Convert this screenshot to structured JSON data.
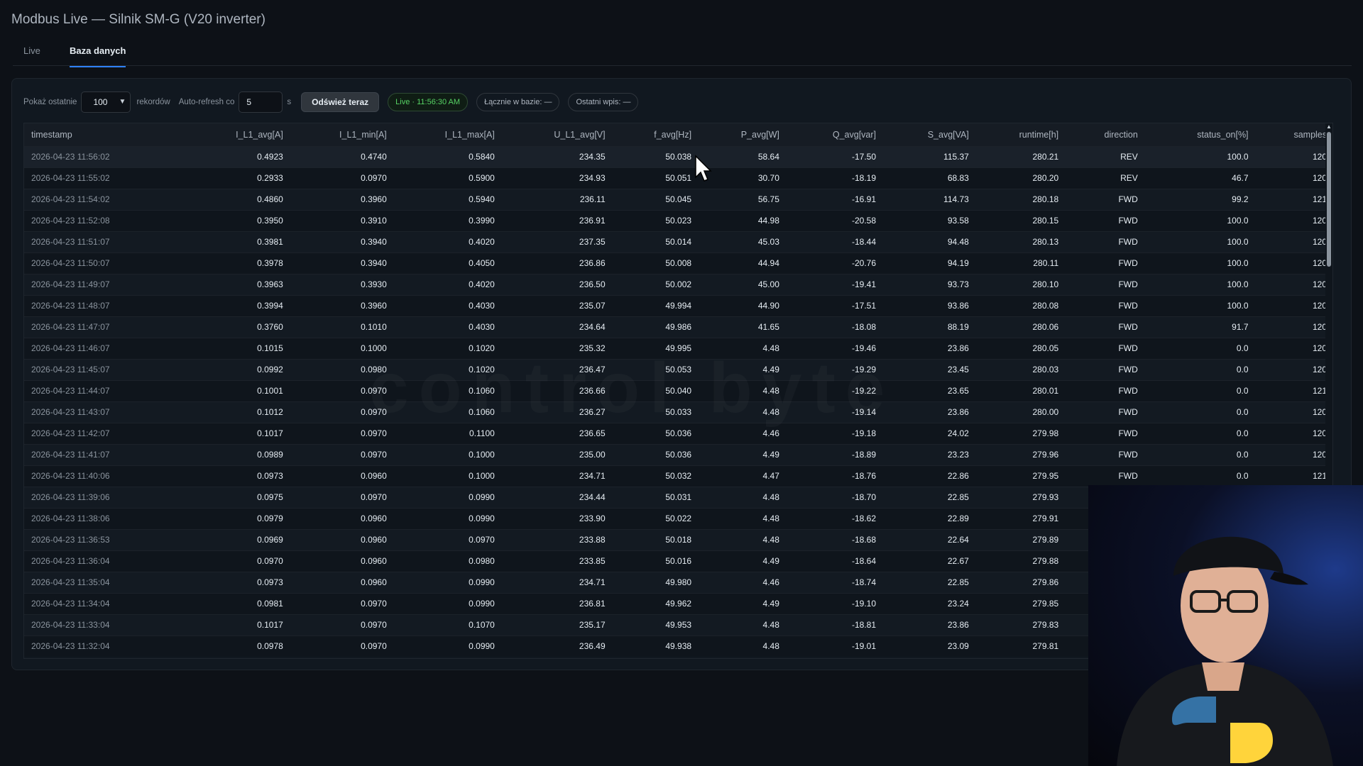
{
  "app": {
    "title": "Modbus Live — Silnik SM-G (V20 inverter)"
  },
  "tabs": [
    {
      "label": "Live"
    },
    {
      "label": "Baza danych"
    }
  ],
  "toolbar": {
    "show_last_label": "Pokaż ostatnie",
    "records_select_value": "100",
    "records_label": "rekordów",
    "autorefresh_label": "Auto-refresh co",
    "autorefresh_value": "5",
    "seconds_unit": "s",
    "refresh_button": "Odśwież teraz",
    "live_status": "Live · 11:56:30 AM",
    "total_in_db": "Łącznie w bazie: —",
    "last_entry": "Ostatni wpis: —"
  },
  "watermark": "control byte",
  "table": {
    "columns": [
      "timestamp",
      "I_L1_avg[A]",
      "I_L1_min[A]",
      "I_L1_max[A]",
      "U_L1_avg[V]",
      "f_avg[Hz]",
      "P_avg[W]",
      "Q_avg[var]",
      "S_avg[VA]",
      "runtime[h]",
      "direction",
      "status_on[%]",
      "samples"
    ],
    "rows": [
      [
        "2026-04-23 11:56:02",
        "0.4923",
        "0.4740",
        "0.5840",
        "234.35",
        "50.038",
        "58.64",
        "-17.50",
        "115.37",
        "280.21",
        "REV",
        "100.0",
        "120"
      ],
      [
        "2026-04-23 11:55:02",
        "0.2933",
        "0.0970",
        "0.5900",
        "234.93",
        "50.051",
        "30.70",
        "-18.19",
        "68.83",
        "280.20",
        "REV",
        "46.7",
        "120"
      ],
      [
        "2026-04-23 11:54:02",
        "0.4860",
        "0.3960",
        "0.5940",
        "236.11",
        "50.045",
        "56.75",
        "-16.91",
        "114.73",
        "280.18",
        "FWD",
        "99.2",
        "121"
      ],
      [
        "2026-04-23 11:52:08",
        "0.3950",
        "0.3910",
        "0.3990",
        "236.91",
        "50.023",
        "44.98",
        "-20.58",
        "93.58",
        "280.15",
        "FWD",
        "100.0",
        "120"
      ],
      [
        "2026-04-23 11:51:07",
        "0.3981",
        "0.3940",
        "0.4020",
        "237.35",
        "50.014",
        "45.03",
        "-18.44",
        "94.48",
        "280.13",
        "FWD",
        "100.0",
        "120"
      ],
      [
        "2026-04-23 11:50:07",
        "0.3978",
        "0.3940",
        "0.4050",
        "236.86",
        "50.008",
        "44.94",
        "-20.76",
        "94.19",
        "280.11",
        "FWD",
        "100.0",
        "120"
      ],
      [
        "2026-04-23 11:49:07",
        "0.3963",
        "0.3930",
        "0.4020",
        "236.50",
        "50.002",
        "45.00",
        "-19.41",
        "93.73",
        "280.10",
        "FWD",
        "100.0",
        "120"
      ],
      [
        "2026-04-23 11:48:07",
        "0.3994",
        "0.3960",
        "0.4030",
        "235.07",
        "49.994",
        "44.90",
        "-17.51",
        "93.86",
        "280.08",
        "FWD",
        "100.0",
        "120"
      ],
      [
        "2026-04-23 11:47:07",
        "0.3760",
        "0.1010",
        "0.4030",
        "234.64",
        "49.986",
        "41.65",
        "-18.08",
        "88.19",
        "280.06",
        "FWD",
        "91.7",
        "120"
      ],
      [
        "2026-04-23 11:46:07",
        "0.1015",
        "0.1000",
        "0.1020",
        "235.32",
        "49.995",
        "4.48",
        "-19.46",
        "23.86",
        "280.05",
        "FWD",
        "0.0",
        "120"
      ],
      [
        "2026-04-23 11:45:07",
        "0.0992",
        "0.0980",
        "0.1020",
        "236.47",
        "50.053",
        "4.49",
        "-19.29",
        "23.45",
        "280.03",
        "FWD",
        "0.0",
        "120"
      ],
      [
        "2026-04-23 11:44:07",
        "0.1001",
        "0.0970",
        "0.1060",
        "236.66",
        "50.040",
        "4.48",
        "-19.22",
        "23.65",
        "280.01",
        "FWD",
        "0.0",
        "121"
      ],
      [
        "2026-04-23 11:43:07",
        "0.1012",
        "0.0970",
        "0.1060",
        "236.27",
        "50.033",
        "4.48",
        "-19.14",
        "23.86",
        "280.00",
        "FWD",
        "0.0",
        "120"
      ],
      [
        "2026-04-23 11:42:07",
        "0.1017",
        "0.0970",
        "0.1100",
        "236.65",
        "50.036",
        "4.46",
        "-19.18",
        "24.02",
        "279.98",
        "FWD",
        "0.0",
        "120"
      ],
      [
        "2026-04-23 11:41:07",
        "0.0989",
        "0.0970",
        "0.1000",
        "235.00",
        "50.036",
        "4.49",
        "-18.89",
        "23.23",
        "279.96",
        "FWD",
        "0.0",
        "120"
      ],
      [
        "2026-04-23 11:40:06",
        "0.0973",
        "0.0960",
        "0.1000",
        "234.71",
        "50.032",
        "4.47",
        "-18.76",
        "22.86",
        "279.95",
        "FWD",
        "0.0",
        "121"
      ],
      [
        "2026-04-23 11:39:06",
        "0.0975",
        "0.0970",
        "0.0990",
        "234.44",
        "50.031",
        "4.48",
        "-18.70",
        "22.85",
        "279.93",
        "",
        "",
        ""
      ],
      [
        "2026-04-23 11:38:06",
        "0.0979",
        "0.0960",
        "0.0990",
        "233.90",
        "50.022",
        "4.48",
        "-18.62",
        "22.89",
        "279.91",
        "",
        "",
        ""
      ],
      [
        "2026-04-23 11:36:53",
        "0.0969",
        "0.0960",
        "0.0970",
        "233.88",
        "50.018",
        "4.48",
        "-18.68",
        "22.64",
        "279.89",
        "",
        "",
        ""
      ],
      [
        "2026-04-23 11:36:04",
        "0.0970",
        "0.0960",
        "0.0980",
        "233.85",
        "50.016",
        "4.49",
        "-18.64",
        "22.67",
        "279.88",
        "",
        "",
        ""
      ],
      [
        "2026-04-23 11:35:04",
        "0.0973",
        "0.0960",
        "0.0990",
        "234.71",
        "49.980",
        "4.46",
        "-18.74",
        "22.85",
        "279.86",
        "",
        "",
        ""
      ],
      [
        "2026-04-23 11:34:04",
        "0.0981",
        "0.0970",
        "0.0990",
        "236.81",
        "49.962",
        "4.49",
        "-19.10",
        "23.24",
        "279.85",
        "",
        "",
        ""
      ],
      [
        "2026-04-23 11:33:04",
        "0.1017",
        "0.0970",
        "0.1070",
        "235.17",
        "49.953",
        "4.48",
        "-18.81",
        "23.86",
        "279.83",
        "",
        "",
        ""
      ],
      [
        "2026-04-23 11:32:04",
        "0.0978",
        "0.0970",
        "0.0990",
        "236.49",
        "49.938",
        "4.48",
        "-19.01",
        "23.09",
        "279.81",
        "",
        "",
        ""
      ]
    ]
  }
}
